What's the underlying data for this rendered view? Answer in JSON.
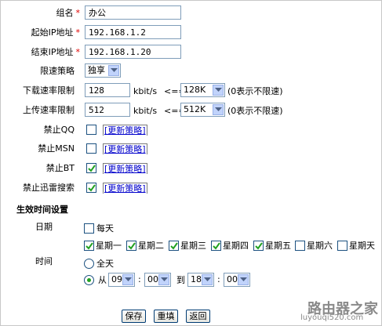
{
  "form": {
    "group_name": {
      "label": "组名",
      "required_mark": "*",
      "value": "办公"
    },
    "start_ip": {
      "label": "起始IP地址",
      "required_mark": "*",
      "value": "192.168.1.2"
    },
    "end_ip": {
      "label": "结束IP地址",
      "required_mark": "*",
      "value": "192.168.1.20"
    },
    "policy": {
      "label": "限速策略",
      "selected": "独享"
    },
    "download": {
      "label": "下载速率限制",
      "value": "128",
      "unit": "kbit/s",
      "le": "<==",
      "selected": "128K",
      "note": "(0表示不限速)"
    },
    "upload": {
      "label": "上传速率限制",
      "value": "512",
      "unit": "kbit/s",
      "le": "<==",
      "selected": "512K",
      "note": "(0表示不限速)"
    },
    "block_qq": {
      "label": "禁止QQ",
      "checked": false,
      "link": "[更新策略]"
    },
    "block_msn": {
      "label": "禁止MSN",
      "checked": false,
      "link": "[更新策略]"
    },
    "block_bt": {
      "label": "禁止BT",
      "checked": true,
      "link": "[更新策略]"
    },
    "block_xunlei": {
      "label": "禁止迅雷搜索",
      "checked": true,
      "link": "[更新策略]"
    }
  },
  "schedule": {
    "title": "生效时间设置",
    "date_label": "日期",
    "everyday": {
      "label": "每天",
      "checked": false
    },
    "days": [
      {
        "label": "星期一",
        "checked": true
      },
      {
        "label": "星期二",
        "checked": true
      },
      {
        "label": "星期三",
        "checked": true
      },
      {
        "label": "星期四",
        "checked": true
      },
      {
        "label": "星期五",
        "checked": true
      },
      {
        "label": "星期六",
        "checked": false
      },
      {
        "label": "星期天",
        "checked": false
      }
    ],
    "time_label": "时间",
    "all_day": {
      "label": "全天",
      "selected": false
    },
    "range": {
      "from_label": "从",
      "to_label": "到",
      "selected": true,
      "from_hour": "09",
      "from_min": "00",
      "to_hour": "18",
      "to_min": "00",
      "sep": ":"
    }
  },
  "buttons": {
    "save": "保存",
    "reset": "重填",
    "back": "返回"
  },
  "watermark": {
    "title": "路由器之家",
    "url": "luyouqi520.com"
  },
  "colors": {
    "accent": "#21a121",
    "link": "#0000cc",
    "required": "#e00000"
  }
}
